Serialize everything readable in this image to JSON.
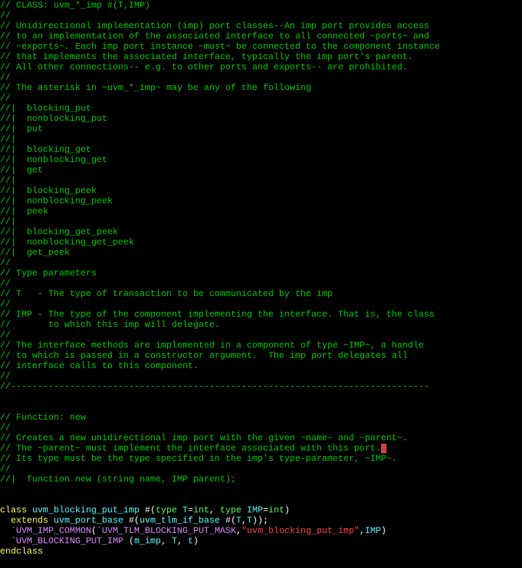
{
  "lines": [
    {
      "segments": [
        {
          "cls": "comment",
          "text": "// CLASS: uvm_*_imp #(T,IMP)"
        }
      ]
    },
    {
      "segments": [
        {
          "cls": "comment",
          "text": "//"
        }
      ]
    },
    {
      "segments": [
        {
          "cls": "comment",
          "text": "// Unidirectional implementation (imp) port classes--An imp port provides access"
        }
      ]
    },
    {
      "segments": [
        {
          "cls": "comment",
          "text": "// to an implementation of the associated interface to all connected ~ports~ and"
        }
      ]
    },
    {
      "segments": [
        {
          "cls": "comment",
          "text": "// ~exports~. Each imp port instance ~must~ be connected to the component instance"
        }
      ]
    },
    {
      "segments": [
        {
          "cls": "comment",
          "text": "// that implements the associated interface, typically the imp port's parent."
        }
      ]
    },
    {
      "segments": [
        {
          "cls": "comment",
          "text": "// All other connections-- e.g. to other ports and exports-- are prohibited."
        }
      ]
    },
    {
      "segments": [
        {
          "cls": "comment",
          "text": "//"
        }
      ]
    },
    {
      "segments": [
        {
          "cls": "comment",
          "text": "// The asterisk in ~uvm_*_imp~ may be any of the following"
        }
      ]
    },
    {
      "segments": [
        {
          "cls": "comment",
          "text": "//"
        }
      ]
    },
    {
      "segments": [
        {
          "cls": "comment",
          "text": "//|  blocking_put"
        }
      ]
    },
    {
      "segments": [
        {
          "cls": "comment",
          "text": "//|  nonblocking_put"
        }
      ]
    },
    {
      "segments": [
        {
          "cls": "comment",
          "text": "//|  put"
        }
      ]
    },
    {
      "segments": [
        {
          "cls": "comment",
          "text": "//|"
        }
      ]
    },
    {
      "segments": [
        {
          "cls": "comment",
          "text": "//|  blocking_get"
        }
      ]
    },
    {
      "segments": [
        {
          "cls": "comment",
          "text": "//|  nonblocking_get"
        }
      ]
    },
    {
      "segments": [
        {
          "cls": "comment",
          "text": "//|  get"
        }
      ]
    },
    {
      "segments": [
        {
          "cls": "comment",
          "text": "//|"
        }
      ]
    },
    {
      "segments": [
        {
          "cls": "comment",
          "text": "//|  blocking_peek"
        }
      ]
    },
    {
      "segments": [
        {
          "cls": "comment",
          "text": "//|  nonblocking_peek"
        }
      ]
    },
    {
      "segments": [
        {
          "cls": "comment",
          "text": "//|  peek"
        }
      ]
    },
    {
      "segments": [
        {
          "cls": "comment",
          "text": "//|"
        }
      ]
    },
    {
      "segments": [
        {
          "cls": "comment",
          "text": "//|  blocking_get_peek"
        }
      ]
    },
    {
      "segments": [
        {
          "cls": "comment",
          "text": "//|  nonblocking_get_peek"
        }
      ]
    },
    {
      "segments": [
        {
          "cls": "comment",
          "text": "//|  get_peek"
        }
      ]
    },
    {
      "segments": [
        {
          "cls": "comment",
          "text": "//"
        }
      ]
    },
    {
      "segments": [
        {
          "cls": "comment",
          "text": "// Type parameters"
        }
      ]
    },
    {
      "segments": [
        {
          "cls": "comment",
          "text": "//"
        }
      ]
    },
    {
      "segments": [
        {
          "cls": "comment",
          "text": "// T   - The type of transaction to be communicated by the imp"
        }
      ]
    },
    {
      "segments": [
        {
          "cls": "comment",
          "text": "//"
        }
      ]
    },
    {
      "segments": [
        {
          "cls": "comment",
          "text": "// IMP - The type of the component implementing the interface. That is, the class"
        }
      ]
    },
    {
      "segments": [
        {
          "cls": "comment",
          "text": "//       to which this imp will delegate."
        }
      ]
    },
    {
      "segments": [
        {
          "cls": "comment",
          "text": "//"
        }
      ]
    },
    {
      "segments": [
        {
          "cls": "comment",
          "text": "// The interface methods are implemented in a component of type ~IMP~, a handle"
        }
      ]
    },
    {
      "segments": [
        {
          "cls": "comment",
          "text": "// to which is passed in a constructor argument.  The imp port delegates all"
        }
      ]
    },
    {
      "segments": [
        {
          "cls": "comment",
          "text": "// interface calls to this component."
        }
      ]
    },
    {
      "segments": [
        {
          "cls": "comment",
          "text": "//"
        }
      ]
    },
    {
      "segments": [
        {
          "cls": "comment",
          "text": "//------------------------------------------------------------------------------"
        }
      ]
    },
    {
      "segments": []
    },
    {
      "segments": []
    },
    {
      "segments": [
        {
          "cls": "comment",
          "text": "// Function: new"
        }
      ]
    },
    {
      "segments": [
        {
          "cls": "comment",
          "text": "//"
        }
      ]
    },
    {
      "segments": [
        {
          "cls": "comment",
          "text": "// Creates a new unidirectional imp port with the given ~name~ and ~parent~."
        }
      ]
    },
    {
      "segments": [
        {
          "cls": "comment",
          "text": "// The ~parent~ must implement the interface associated with this port."
        },
        {
          "cls": "cursor",
          "text": ""
        }
      ]
    },
    {
      "segments": [
        {
          "cls": "comment",
          "text": "// Its type must be the type specified in the imp's type-parameter, ~IMP~."
        }
      ]
    },
    {
      "segments": [
        {
          "cls": "comment",
          "text": "//"
        }
      ]
    },
    {
      "segments": [
        {
          "cls": "comment",
          "text": "//|  function new (string name, IMP parent);"
        }
      ]
    },
    {
      "segments": []
    },
    {
      "segments": []
    },
    {
      "segments": [
        {
          "cls": "keyword",
          "text": "class "
        },
        {
          "cls": "ident",
          "text": "uvm_blocking_put_imp "
        },
        {
          "cls": "paren",
          "text": "#("
        },
        {
          "cls": "typekw",
          "text": "type "
        },
        {
          "cls": "ident",
          "text": "T"
        },
        {
          "cls": "operator",
          "text": "="
        },
        {
          "cls": "builtin",
          "text": "int"
        },
        {
          "cls": "operator",
          "text": ", "
        },
        {
          "cls": "typekw",
          "text": "type "
        },
        {
          "cls": "ident",
          "text": "IMP"
        },
        {
          "cls": "operator",
          "text": "="
        },
        {
          "cls": "builtin",
          "text": "int"
        },
        {
          "cls": "paren",
          "text": ")"
        }
      ]
    },
    {
      "segments": [
        {
          "cls": "operator",
          "text": "  "
        },
        {
          "cls": "keyword",
          "text": "extends "
        },
        {
          "cls": "ident",
          "text": "uvm_port_base "
        },
        {
          "cls": "paren",
          "text": "#("
        },
        {
          "cls": "ident",
          "text": "uvm_tlm_if_base "
        },
        {
          "cls": "paren",
          "text": "#("
        },
        {
          "cls": "ident",
          "text": "T"
        },
        {
          "cls": "operator",
          "text": ","
        },
        {
          "cls": "ident",
          "text": "T"
        },
        {
          "cls": "paren",
          "text": "))"
        },
        {
          "cls": "operator",
          "text": ";"
        }
      ]
    },
    {
      "segments": [
        {
          "cls": "operator",
          "text": "  "
        },
        {
          "cls": "macro",
          "text": "`UVM_IMP_COMMON"
        },
        {
          "cls": "paren",
          "text": "("
        },
        {
          "cls": "macro",
          "text": "`UVM_TLM_BLOCKING_PUT_MASK"
        },
        {
          "cls": "operator",
          "text": ","
        },
        {
          "cls": "string",
          "text": "\"uvm_blocking_put_imp\""
        },
        {
          "cls": "operator",
          "text": ","
        },
        {
          "cls": "ident",
          "text": "IMP"
        },
        {
          "cls": "paren",
          "text": ")"
        }
      ]
    },
    {
      "segments": [
        {
          "cls": "operator",
          "text": "  "
        },
        {
          "cls": "macro",
          "text": "`UVM_BLOCKING_PUT_IMP "
        },
        {
          "cls": "paren",
          "text": "("
        },
        {
          "cls": "ident",
          "text": "m_imp"
        },
        {
          "cls": "operator",
          "text": ", "
        },
        {
          "cls": "ident",
          "text": "T"
        },
        {
          "cls": "operator",
          "text": ", "
        },
        {
          "cls": "ident",
          "text": "t"
        },
        {
          "cls": "paren",
          "text": ")"
        }
      ]
    },
    {
      "segments": [
        {
          "cls": "keyword",
          "text": "endclass"
        }
      ]
    }
  ]
}
